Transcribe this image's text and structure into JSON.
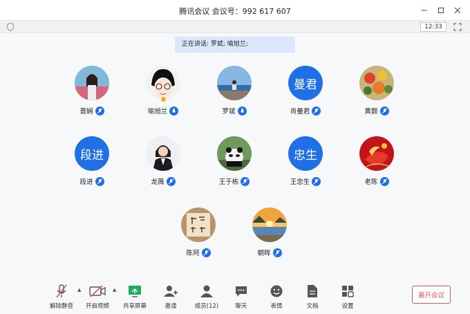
{
  "window": {
    "title": "腾讯会议 会议号：992 617 607"
  },
  "topbar": {
    "clock": "12:33"
  },
  "speaking": {
    "text": "正在讲话: 罗斌; 喻旭兰;"
  },
  "participants": [
    {
      "name": "晋娴",
      "avatar": "photo"
    },
    {
      "name": "喻旭兰",
      "avatar": "photo"
    },
    {
      "name": "罗斌",
      "avatar": "photo"
    },
    {
      "name": "肖曼君",
      "avatar": "曼君"
    },
    {
      "name": "黄颢",
      "avatar": "photo"
    },
    {
      "name": "段进",
      "avatar": "段进"
    },
    {
      "name": "龙薇",
      "avatar": "photo"
    },
    {
      "name": "王于栋",
      "avatar": "photo"
    },
    {
      "name": "王忠生",
      "avatar": "忠生"
    },
    {
      "name": "老陈",
      "avatar": "photo"
    },
    {
      "name": "陈珂",
      "avatar": "photo"
    },
    {
      "name": "朝晖",
      "avatar": "photo"
    }
  ],
  "toolbar": {
    "unmute": "解除静音",
    "video": "开启视频",
    "share": "共享屏幕",
    "invite": "邀请",
    "members": "成员(12)",
    "chat": "聊天",
    "emoji": "表情",
    "docs": "文档",
    "settings": "设置",
    "leave": "离开会议"
  },
  "colors": {
    "accent": "#1f6fe6",
    "leave": "#e35454",
    "share_green": "#1aad5b"
  }
}
